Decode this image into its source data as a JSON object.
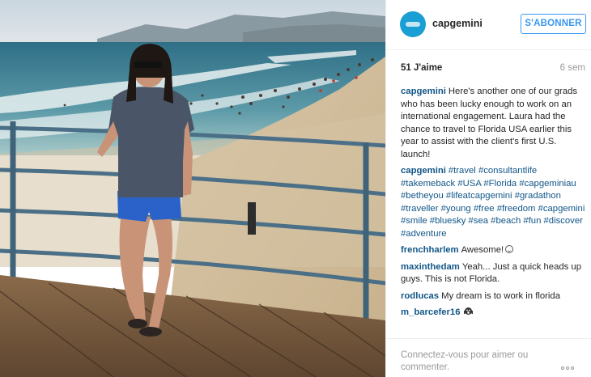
{
  "colors": {
    "link": "#125688",
    "accent": "#3897f0",
    "muted": "#999999",
    "text": "#262626",
    "brand": "#1a9fd4"
  },
  "photo": {
    "description_icon": "beach-pier-photo"
  },
  "header": {
    "username": "capgemini",
    "follow_label": "S'ABONNER"
  },
  "meta": {
    "likes": "51 J'aime",
    "age": "6 sem"
  },
  "caption": {
    "author": "capgemini",
    "text": "Here's another one of our grads who has been lucky enough to work on an international engagement. Laura had the chance to travel to Florida USA earlier this year to assist with the client's first U.S. launch!"
  },
  "hashtags_comment": {
    "author": "capgemini",
    "tags": [
      "#travel",
      "#consultantlife",
      "#takemeback",
      "#USA",
      "#Florida",
      "#capgeminiau",
      "#betheyou",
      "#lifeatcapgemini",
      "#gradathon",
      "#traveller",
      "#young",
      "#free",
      "#freedom",
      "#capgemini",
      "#smile",
      "#bluesky",
      "#sea",
      "#beach",
      "#fun",
      "#discover",
      "#adventure"
    ]
  },
  "comments": [
    {
      "author": "frenchharlem",
      "text": "Awesome!",
      "emoji": "smile-emoji"
    },
    {
      "author": "maxinthedam",
      "text": "Yeah... Just a quick heads up guys. This is not Florida.",
      "emoji": ""
    },
    {
      "author": "rodlucas",
      "text": "My dream is to work in florida",
      "emoji": ""
    },
    {
      "author": "m_barcefer16",
      "text": "",
      "emoji": "scream-emoji"
    }
  ],
  "footer": {
    "login_text": "Connectez-vous pour aimer ou commenter.",
    "more_icon": "more-options-icon"
  }
}
